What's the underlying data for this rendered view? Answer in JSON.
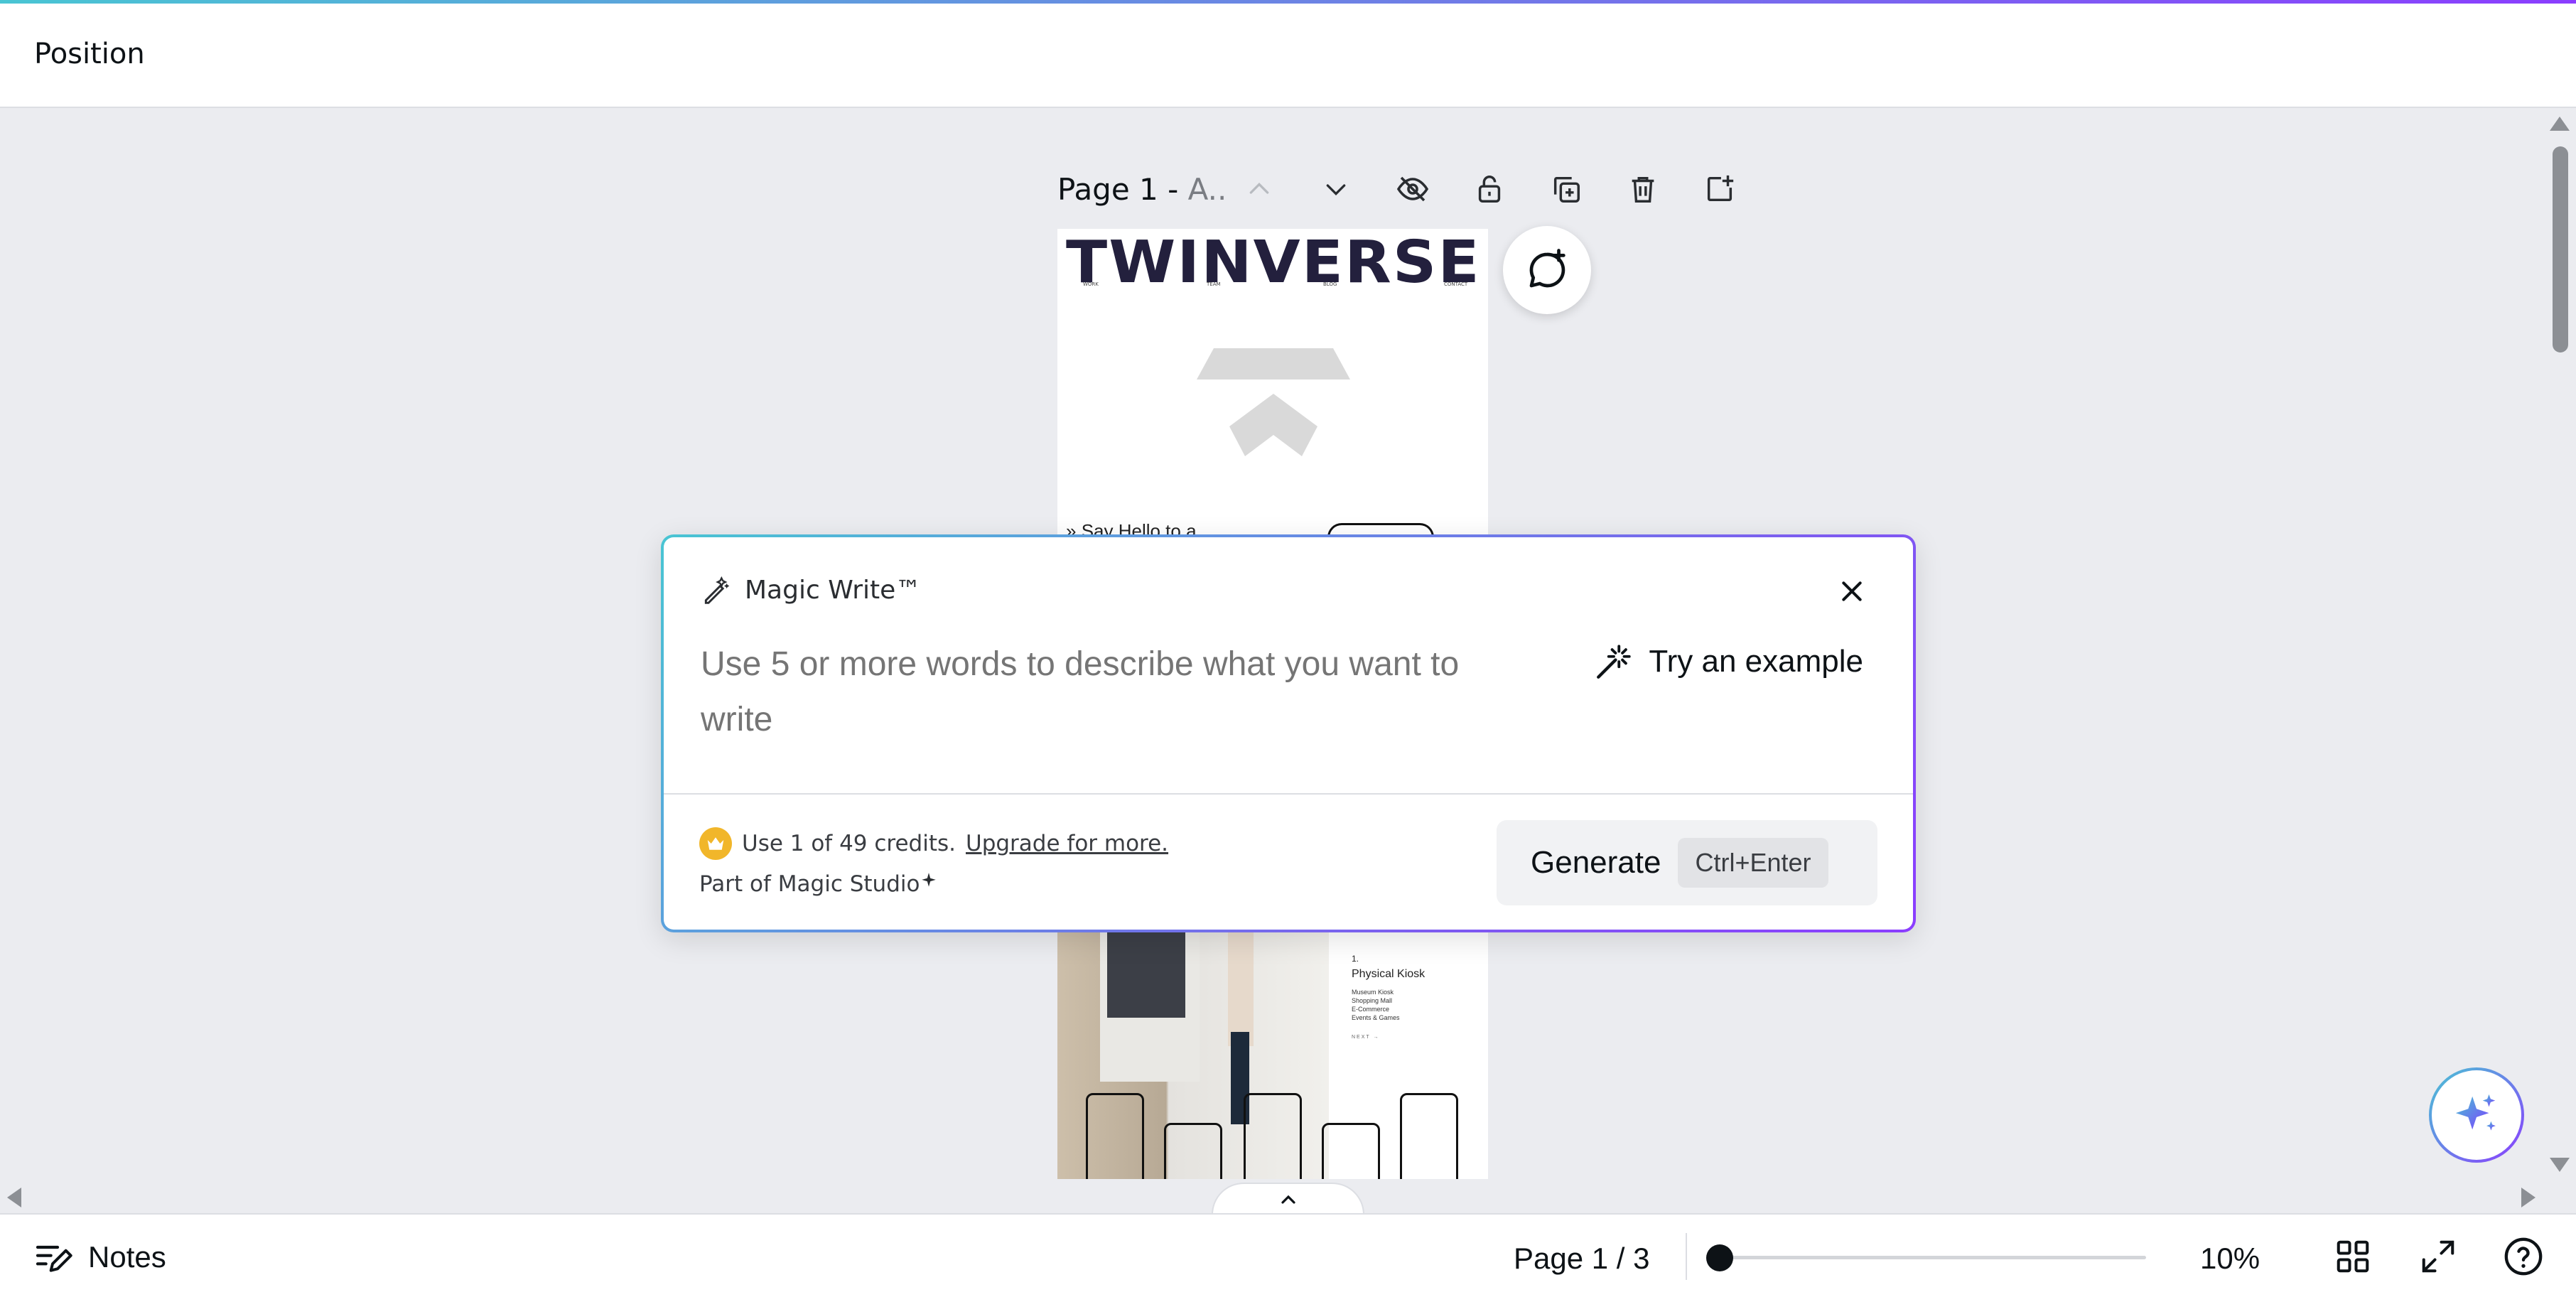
{
  "header": {
    "title": "Position"
  },
  "page_toolbar": {
    "page_label": "Page 1 -",
    "page_subtitle": "A..",
    "icons": [
      "chevron-up-icon",
      "chevron-down-icon",
      "eye-icon",
      "unlock-icon",
      "duplicate-icon",
      "trash-icon",
      "add-page-icon"
    ]
  },
  "design": {
    "brand": "TWINVERSE",
    "nav": [
      "WORK",
      "TEAM",
      "BLOG",
      "CONTACT"
    ],
    "headline": "Say Hello to a",
    "kiosk_number": "1.",
    "kiosk_title": "Physical Kiosk",
    "kiosk_items": [
      "Museum Kiosk",
      "Shopping Mall",
      "E-Commerce",
      "Events & Games"
    ],
    "kiosk_next": "NEXT →"
  },
  "magic_write": {
    "title": "Magic Write™",
    "placeholder": "Use 5 or more words to describe what you want to write",
    "try_example": "Try an example",
    "credits_text": "Use 1 of 49 credits.",
    "upgrade_link": "Upgrade for more.",
    "studio_text": "Part of Magic Studio",
    "generate_label": "Generate",
    "shortcut": "Ctrl+Enter"
  },
  "footer": {
    "notes_label": "Notes",
    "page_info": "Page 1 / 3",
    "zoom_level": "10%",
    "zoom_fraction": 0.0
  },
  "colors": {
    "accent_start": "#49c5d3",
    "accent_end": "#8b3dff",
    "crown": "#f1b62a",
    "brand_text": "#23203d"
  }
}
